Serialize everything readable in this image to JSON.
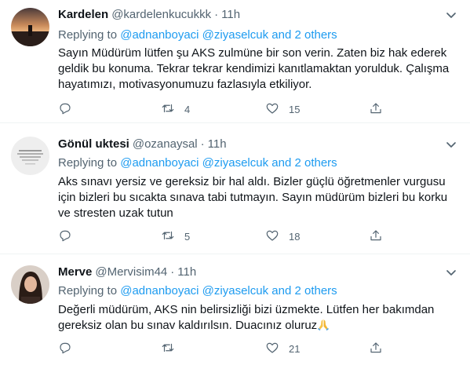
{
  "tweets": [
    {
      "name": "Kardelen",
      "handle": "@kardelenkucukkk",
      "time": "11h",
      "replying_prefix": "Replying to",
      "mentions": "@adnanboyaci @ziyaselcuk",
      "others": "and 2 others",
      "lines": [
        "Sayın Müdürüm lütfen şu AKS zulmüne bir son verin. Zaten biz hak ederek",
        "geldik bu konuma. Tekrar tekrar kendimizi kanıtlamaktan yorulduk. Çalışma",
        "hayatımızı, motivasyonumuzu fazlasıyla etkiliyor."
      ],
      "replies": "",
      "retweets": "4",
      "likes": "15",
      "share": ""
    },
    {
      "name": "Gönül uktesi",
      "handle": "@ozanaysal",
      "time": "11h",
      "replying_prefix": "Replying to",
      "mentions": "@adnanboyaci @ziyaselcuk",
      "others": "and 2 others",
      "lines": [
        "Aks sınavı yersiz ve gereksiz bir hal aldı. Bizler güçlü öğretmenler vurgusu",
        "için bizleri bu sıcakta sınava tabi tutmayın. Sayın müdürüm bizleri bu korku",
        "ve stresten uzak tutun"
      ],
      "replies": "",
      "retweets": "5",
      "likes": "18",
      "share": ""
    },
    {
      "name": "Merve",
      "handle": "@Mervisim44",
      "time": "11h",
      "replying_prefix": "Replying to",
      "mentions": "@adnanboyaci @ziyaselcuk",
      "others": "and 2 others",
      "lines": [
        "Değerli müdürüm, AKS nin belirsizliği bizi üzmekte. Lütfen her bakımdan",
        "gereksiz olan bu sınav kaldırılsın. Duacınız oluruz"
      ],
      "replies": "",
      "retweets": "",
      "likes": "21",
      "share": ""
    }
  ],
  "separator": "·",
  "colors": {
    "text": "#0f1419",
    "secondary": "#536471",
    "link": "#1d9bf0",
    "divider": "#eff3f4"
  },
  "icons": {
    "reply": "reply-icon",
    "retweet": "retweet-icon",
    "like": "heart-icon",
    "share": "share-icon",
    "more": "chevron-down-icon",
    "emoji": "folded-hands-emoji"
  }
}
